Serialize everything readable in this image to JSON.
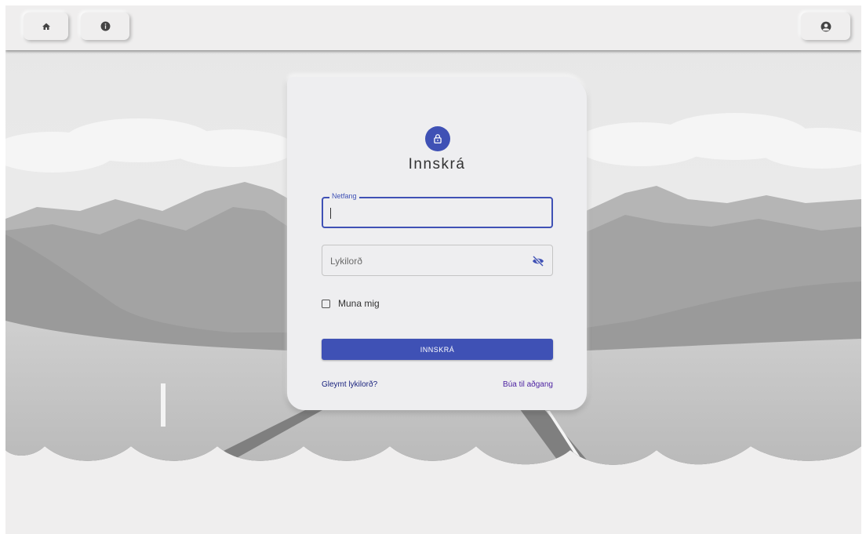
{
  "topbar": {
    "home_icon": "home-icon",
    "info_icon": "info-circle-icon",
    "account_icon": "user-circle-icon"
  },
  "login": {
    "lock_icon": "lock-icon",
    "title": "Innskrá",
    "email": {
      "label": "Netfang",
      "value": ""
    },
    "password": {
      "placeholder": "Lykilorð",
      "visibility_icon": "eye-off-icon"
    },
    "remember_label": "Muna mig",
    "remember_checked": false,
    "submit_label": "INNSKRÁ",
    "forgot_link": "Gleymt lykilorð?",
    "signup_link": "Búa til aðgang"
  },
  "colors": {
    "primary": "#3f51b5",
    "background": "#efeeee",
    "card": "#eeeef0"
  }
}
